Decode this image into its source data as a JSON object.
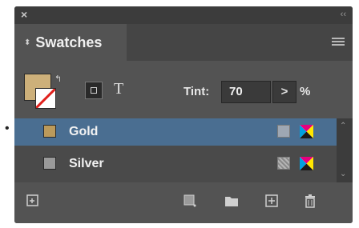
{
  "panel": {
    "close_glyph": "×",
    "collapse_glyph": "‹‹",
    "tab_arrows": "⬍",
    "tab_label": "Swatches",
    "menu_icon": "hamburger-menu-icon"
  },
  "controls": {
    "fill_color": "#cdb07a",
    "stroke_color": "none",
    "text_icon": "T",
    "tint_label": "Tint:",
    "tint_value": "70",
    "tint_stepper": ">",
    "tint_unit": "%"
  },
  "swatches": [
    {
      "name": "Gold",
      "color": "#bb9a5b",
      "selected": true,
      "type_icon": "process-color-icon",
      "mode_icon": "cmyk-mode-icon"
    },
    {
      "name": "Silver",
      "color": "#9a9a9a",
      "selected": false,
      "type_icon": "spot-color-icon",
      "mode_icon": "cmyk-mode-icon"
    }
  ],
  "bullet": "•",
  "footer_icons": [
    "load-swatches-icon",
    "new-color-group-icon",
    "folder-icon",
    "new-swatch-icon",
    "trash-icon"
  ],
  "colors": {
    "panel_bg": "#535353",
    "selection": "#4a6e91"
  }
}
